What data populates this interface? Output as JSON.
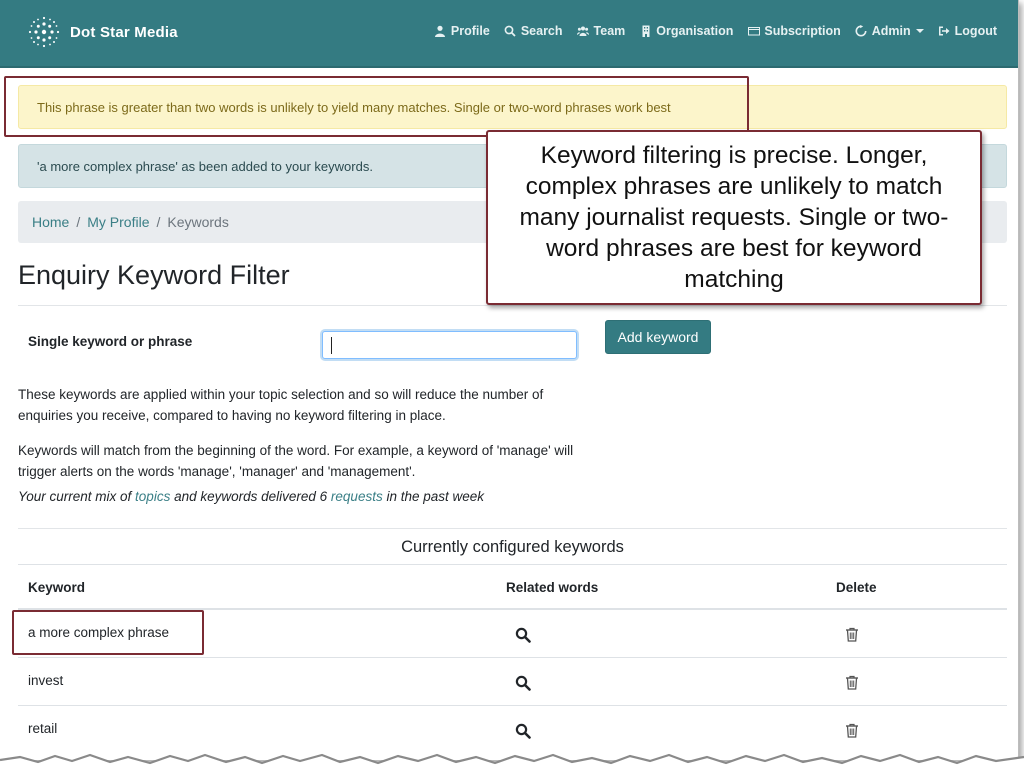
{
  "brand": {
    "name": "Dot Star Media"
  },
  "nav": [
    {
      "label": "Profile",
      "icon": "user-icon"
    },
    {
      "label": "Search",
      "icon": "search-icon"
    },
    {
      "label": "Team",
      "icon": "team-icon"
    },
    {
      "label": "Organisation",
      "icon": "building-icon"
    },
    {
      "label": "Subscription",
      "icon": "credit-card-icon"
    },
    {
      "label": "Admin",
      "icon": "refresh-icon",
      "dropdown": true
    },
    {
      "label": "Logout",
      "icon": "logout-icon"
    }
  ],
  "alerts": {
    "warning": "This phrase is greater than two words is unlikely to yield many matches. Single or two-word phrases work best",
    "info": "'a more complex phrase' as been added to your keywords."
  },
  "callout": {
    "text": "Keyword filtering is precise. Longer, complex phrases are unlikely to match many journalist requests. Single or two-word phrases are best for keyword matching"
  },
  "breadcrumb": {
    "home": "Home",
    "profile": "My Profile",
    "current": "Keywords",
    "separator": "/"
  },
  "page": {
    "title": "Enquiry Keyword Filter"
  },
  "form": {
    "label": "Single keyword or phrase",
    "input_value": "",
    "add_button": "Add keyword"
  },
  "info_text": {
    "p1": "These keywords are applied within your topic selection and so will reduce the number of enquiries you receive, compared to having no keyword filtering in place.",
    "p2": "Keywords will match from the beginning of the word. For example, a keyword of 'manage' will trigger alerts on the words 'manage', 'manager' and 'management'.",
    "p3_a": "Your current mix of ",
    "p3_link1": "topics",
    "p3_b": " and keywords delivered 6 ",
    "p3_link2": "requests",
    "p3_c": " in the past week"
  },
  "table": {
    "title": "Currently configured keywords",
    "headers": {
      "keyword": "Keyword",
      "related": "Related words",
      "delete": "Delete"
    },
    "rows": [
      {
        "keyword": "a more complex phrase"
      },
      {
        "keyword": "invest"
      },
      {
        "keyword": "retail"
      }
    ]
  },
  "colors": {
    "navbar": "#347b82",
    "warning_bg": "#fcf5cb",
    "info_bg": "#d5e3e6",
    "highlight": "#7a2b33",
    "link": "#3a7f86"
  }
}
